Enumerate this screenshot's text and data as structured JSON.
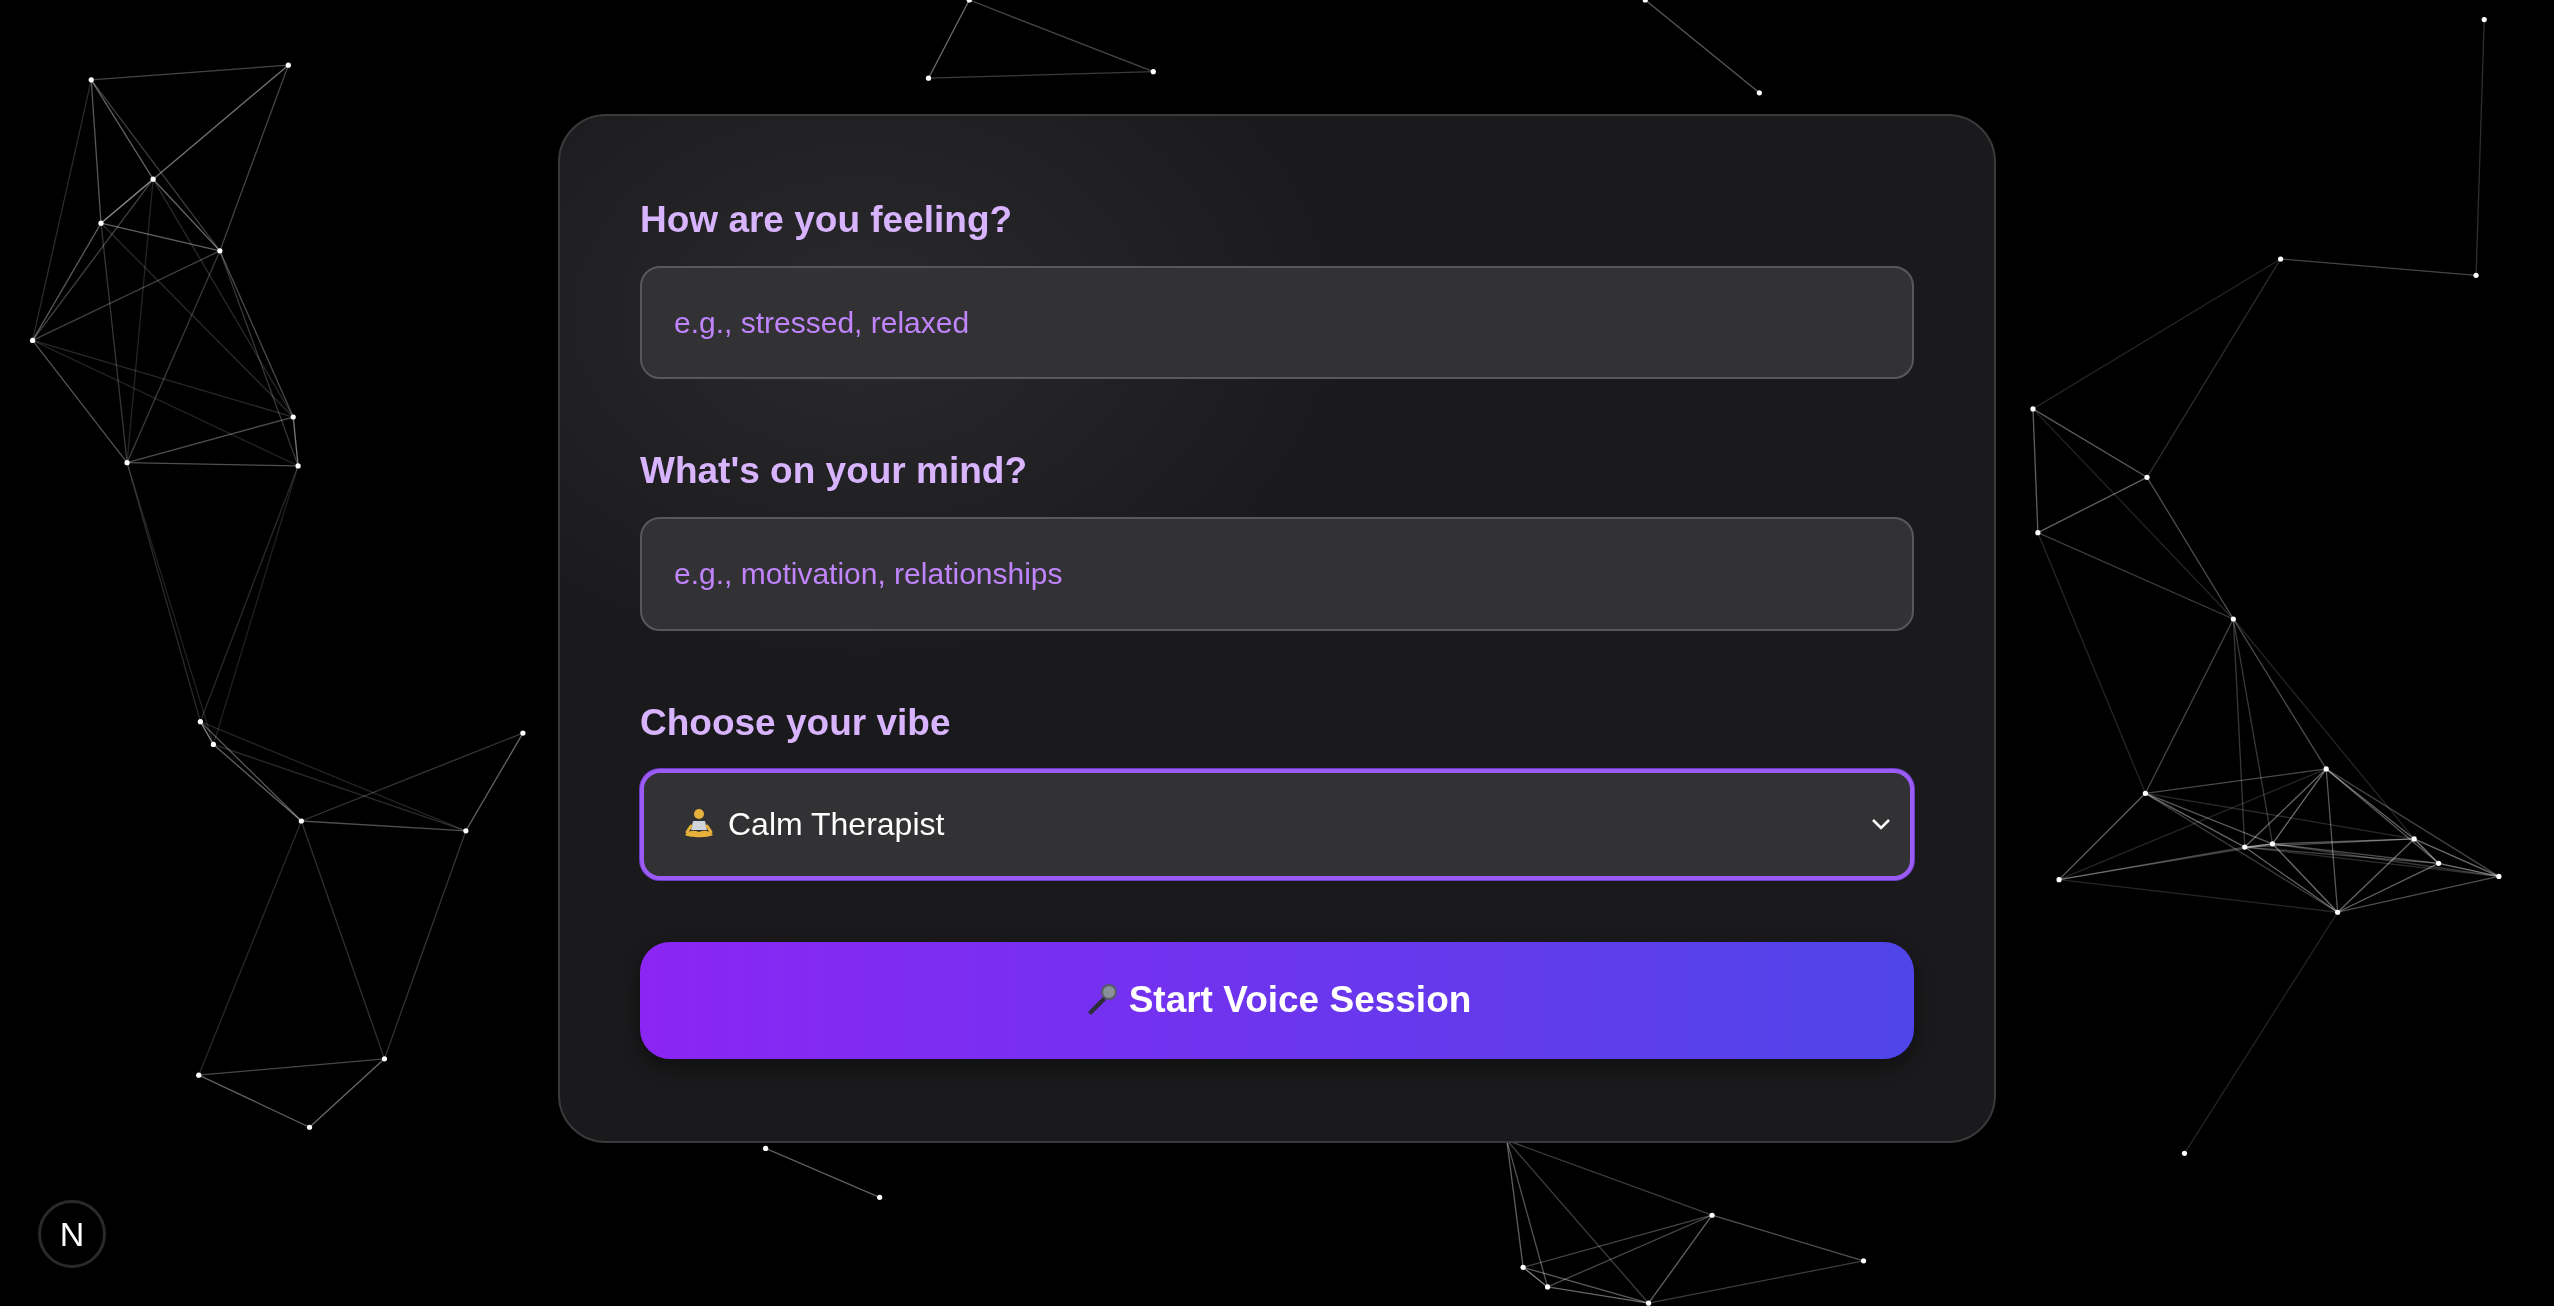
{
  "form": {
    "fields": [
      {
        "kind": "text",
        "label": "How are you feeling?",
        "placeholder": "e.g., stressed, relaxed"
      },
      {
        "kind": "text",
        "label": "What's on your mind?",
        "placeholder": "e.g., motivation, relationships"
      },
      {
        "kind": "select",
        "label": "Choose your vibe",
        "value": "Calm Therapist",
        "focused": true
      }
    ],
    "submit": {
      "label": "Start Voice Session"
    }
  },
  "corner_badge": {
    "letter": "N"
  }
}
